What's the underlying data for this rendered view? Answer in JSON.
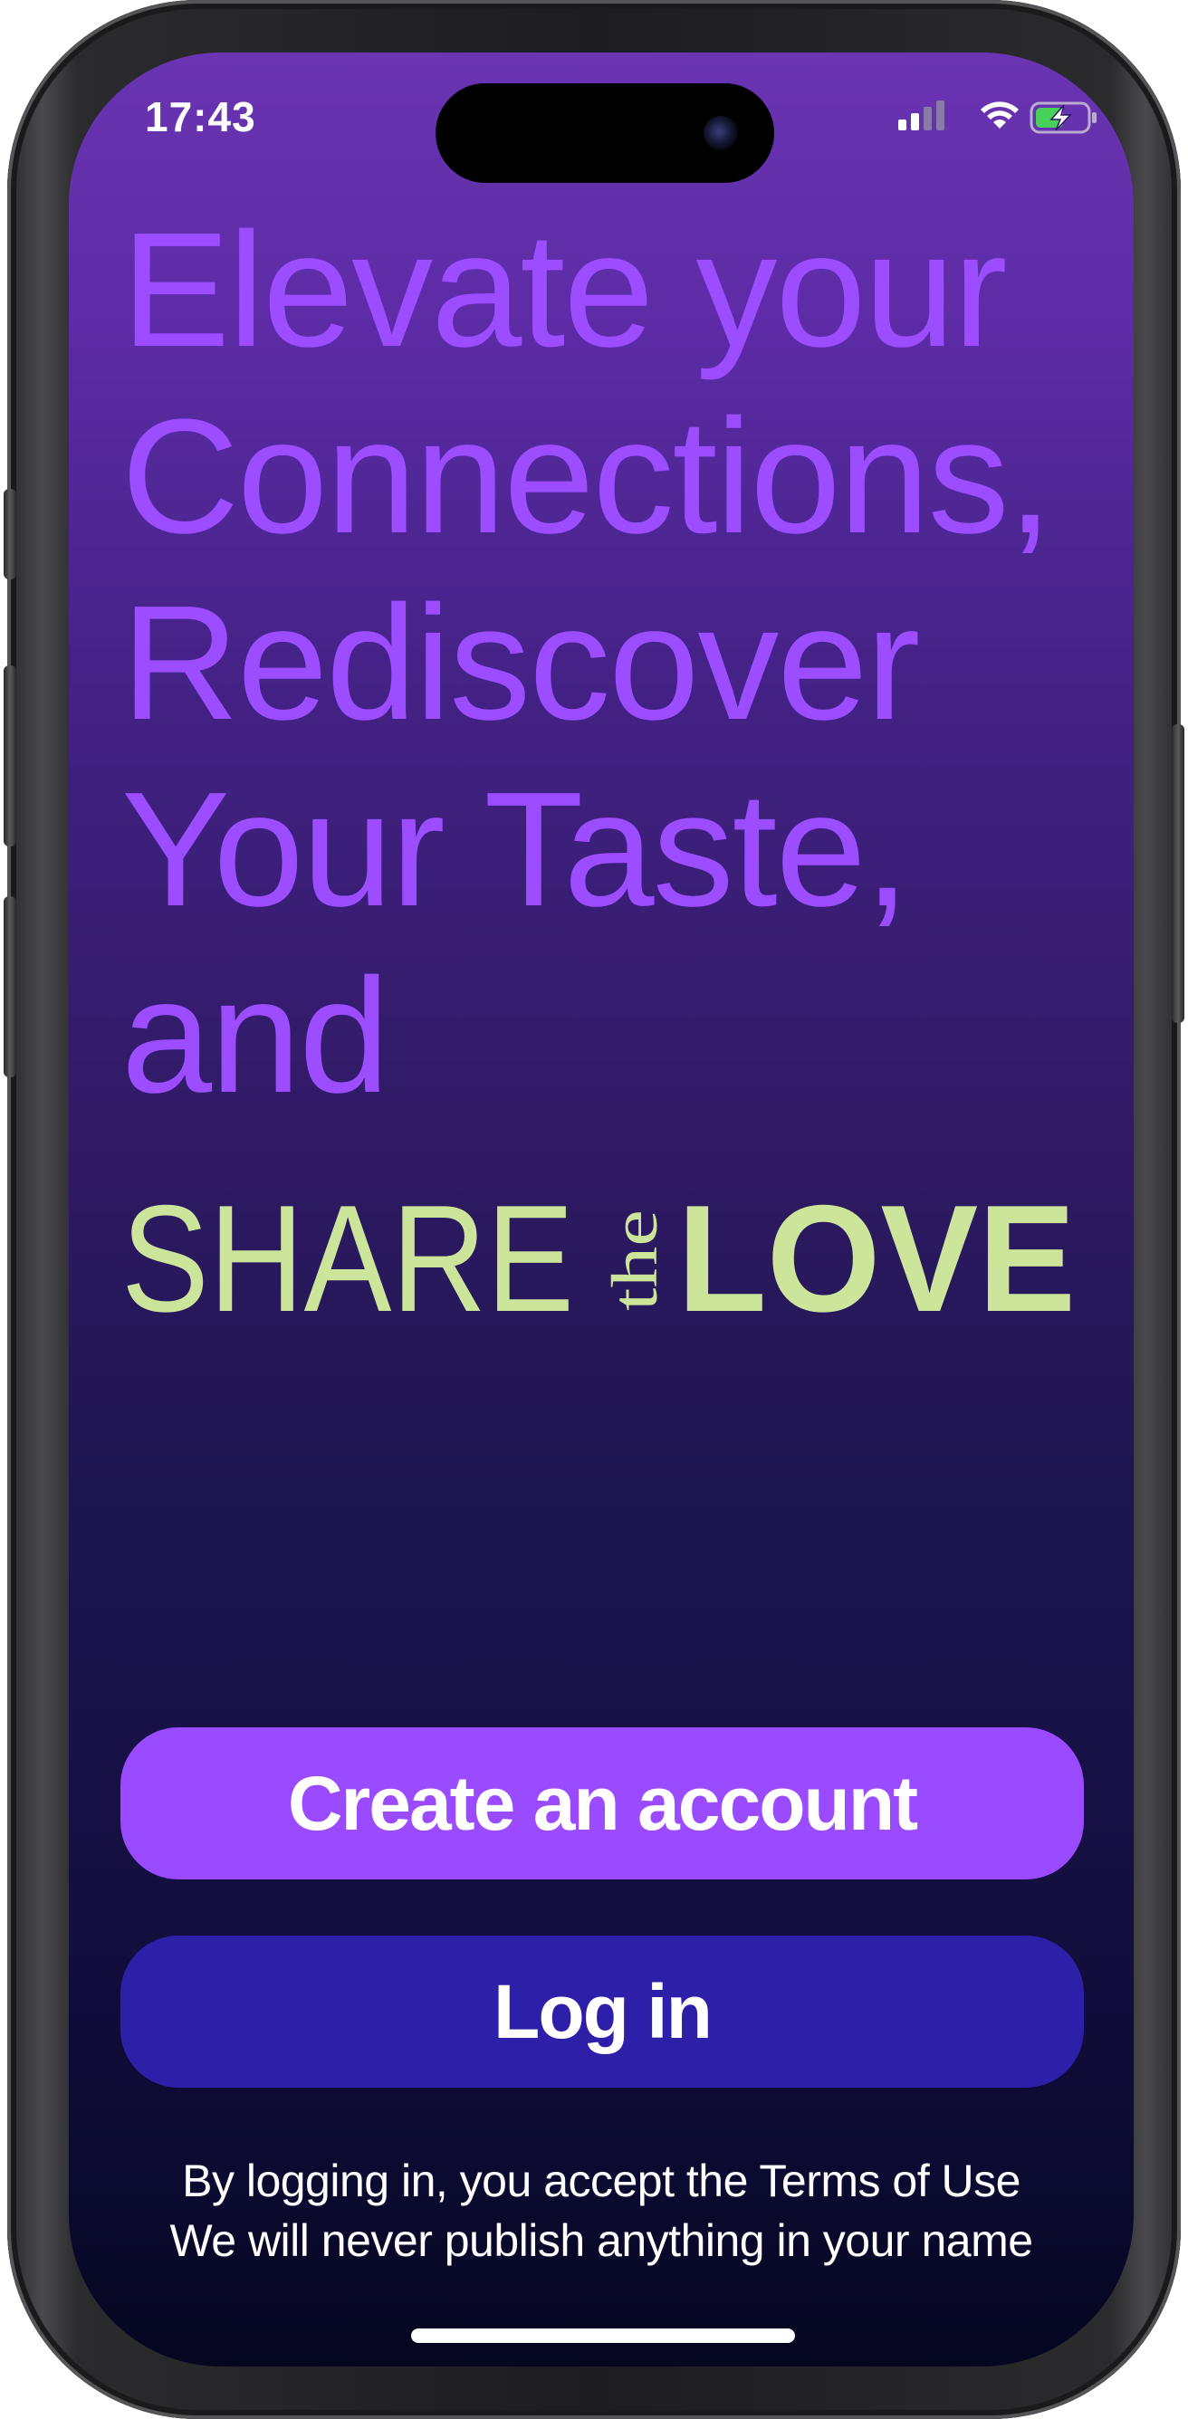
{
  "status_bar": {
    "time": "17:43",
    "signal_icon": "cellular-signal-icon",
    "wifi_icon": "wifi-icon",
    "battery_icon": "battery-charging-icon"
  },
  "hero": {
    "headline_lines": [
      "Elevate your",
      "Connections,",
      "Rediscover",
      "Your Taste,",
      "and"
    ],
    "brand_logo": {
      "word_1": "SHARE",
      "word_2": "the",
      "word_3": "LOVE"
    }
  },
  "actions": {
    "create_account_label": "Create an account",
    "log_in_label": "Log in"
  },
  "legal": {
    "line_1": "By logging in, you accept the Terms of Use",
    "line_2": "We will never publish anything in your name"
  },
  "colors": {
    "headline": "#9b4dff",
    "brand_logo": "#cde59a",
    "create_button": "#9a4bff",
    "login_button": "#2e1fa8",
    "background_top": "#6a34b2",
    "background_bottom": "#05061f"
  }
}
